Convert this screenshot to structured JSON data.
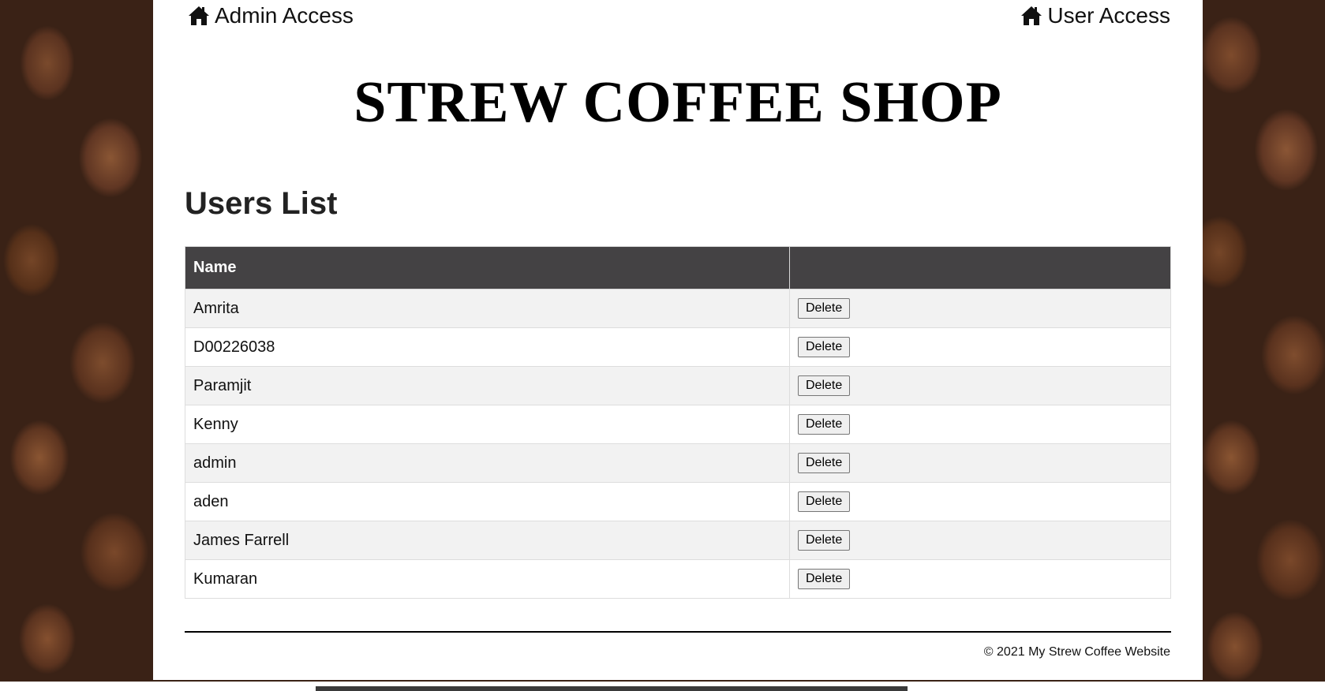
{
  "nav": {
    "admin_label": "Admin Access",
    "user_label": "User Access",
    "icon": "home-icon"
  },
  "site": {
    "title": "STREW COFFEE SHOP"
  },
  "users": {
    "heading": "Users List",
    "columns": [
      "Name",
      ""
    ],
    "delete_label": "Delete",
    "rows": [
      {
        "name": "Amrita"
      },
      {
        "name": "D00226038"
      },
      {
        "name": "Paramjit"
      },
      {
        "name": "Kenny"
      },
      {
        "name": "admin"
      },
      {
        "name": "aden"
      },
      {
        "name": "James Farrell"
      },
      {
        "name": "Kumaran"
      }
    ]
  },
  "footer": {
    "text": "© 2021 My Strew Coffee Website"
  },
  "colors": {
    "header_bg": "#444244",
    "row_alt": "#f2f2f2"
  }
}
